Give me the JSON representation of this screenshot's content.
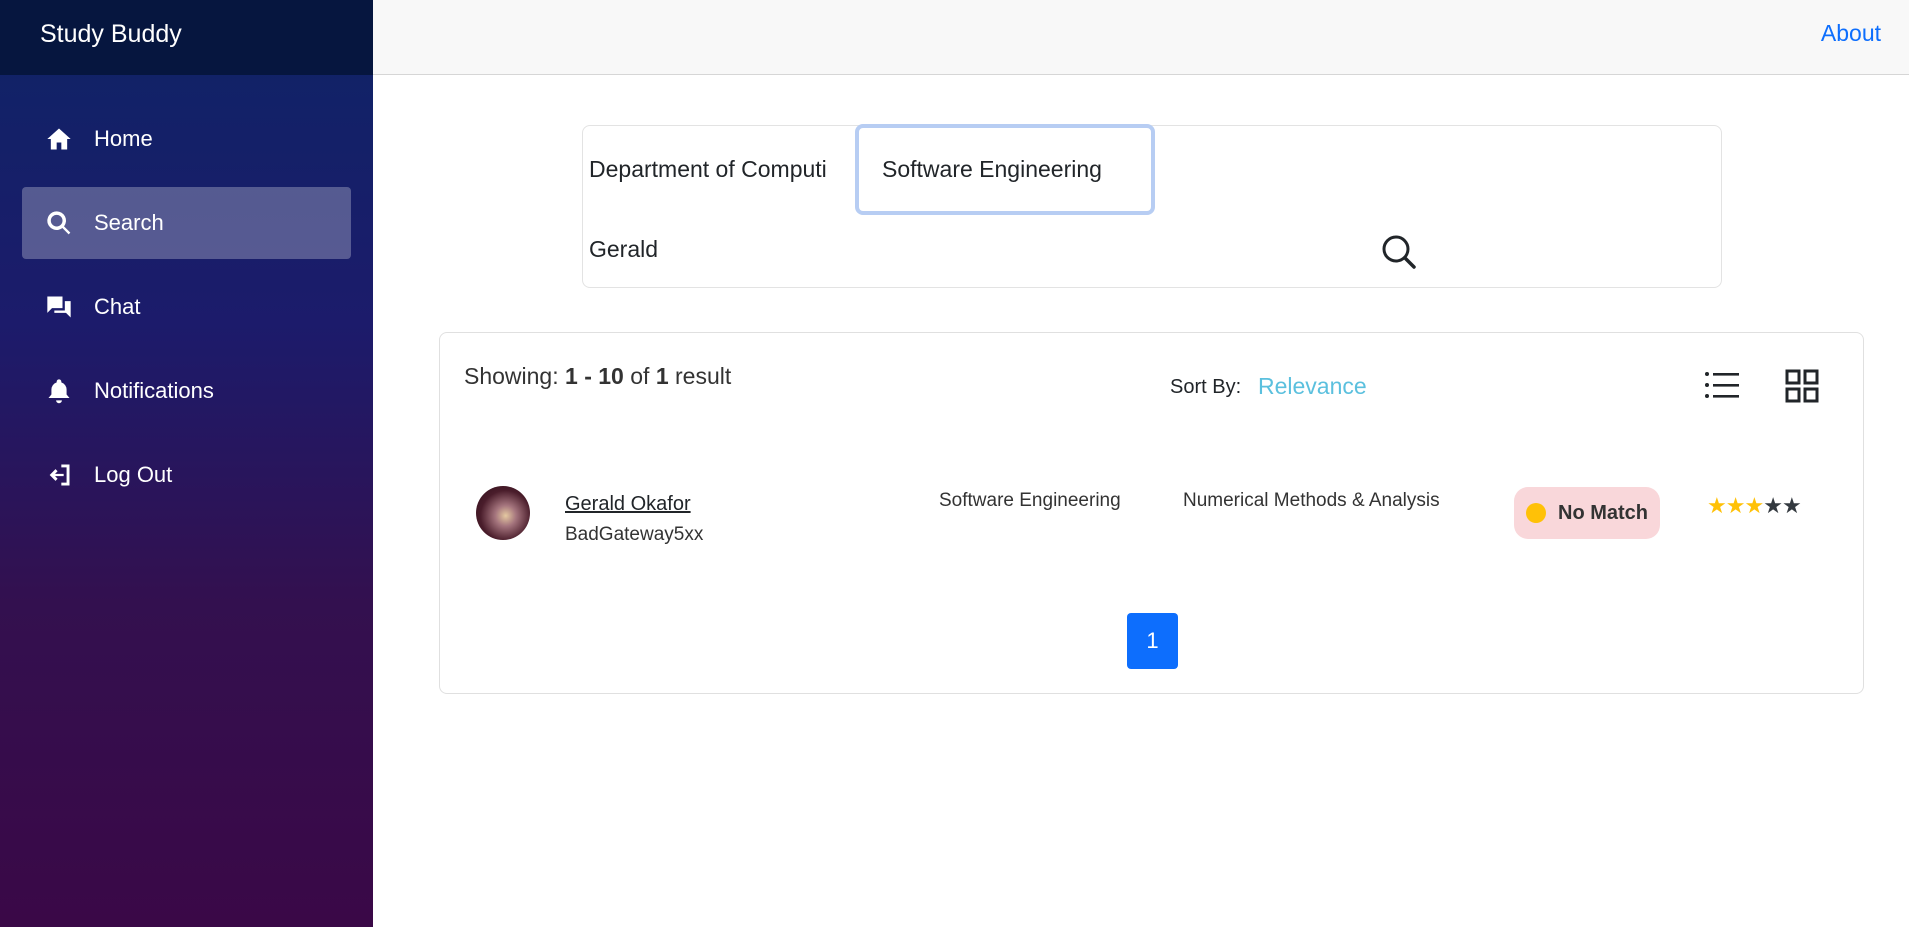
{
  "app": {
    "title": "Study Buddy"
  },
  "sidebar": {
    "items": [
      {
        "label": "Home",
        "icon": "home-icon",
        "active": false
      },
      {
        "label": "Search",
        "icon": "search-icon",
        "active": true
      },
      {
        "label": "Chat",
        "icon": "chat-icon",
        "active": false
      },
      {
        "label": "Notifications",
        "icon": "bell-icon",
        "active": false
      },
      {
        "label": "Log Out",
        "icon": "logout-icon",
        "active": false
      }
    ]
  },
  "topbar": {
    "about_label": "About"
  },
  "search": {
    "department": "Department of Computi",
    "major": "Software Engineering",
    "name": "Gerald"
  },
  "results": {
    "showing_label": "Showing:",
    "range": "1 - 10",
    "of_label": "of",
    "count": "1",
    "result_label": "result",
    "sort_label": "Sort By:",
    "sort_value": "Relevance",
    "rows": [
      {
        "name": "Gerald Okafor",
        "handle": "BadGateway5xx",
        "major": "Software Engineering",
        "course": "Numerical Methods & Analysis",
        "match_status": "No Match",
        "rating": 3,
        "rating_max": 5
      }
    ],
    "current_page": "1"
  },
  "colors": {
    "accent": "#0d6efd",
    "sort_link": "#5bc0de",
    "badge_bg": "#f9d7da",
    "badge_dot": "#ffc107"
  }
}
